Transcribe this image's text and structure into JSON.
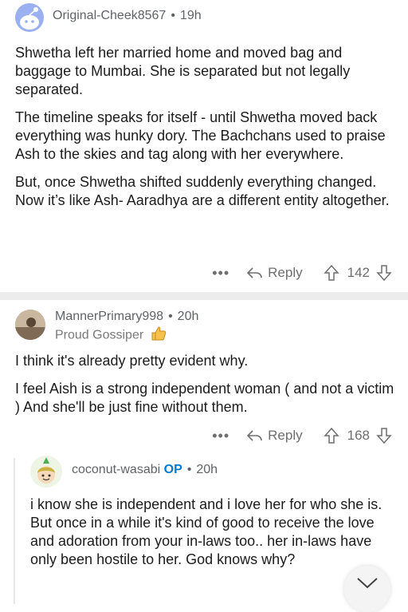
{
  "comment1": {
    "username": "Original-Cheek8567",
    "time": "19h",
    "paragraphs": [
      "Shwetha left her married home and moved bag and baggage to Mumbai. She is separated but not legally separated.",
      "The timeline speaks for itself - until Shwetha moved back everything was hunky dory. The Bachchans used to praise Ash to the skies and tag along with her everywhere.",
      "But, once Shwetha shifted suddenly everything changed. Now it’s like Ash- Aaradhya are a different entity altogether."
    ],
    "reply_label": "Reply",
    "score": "142"
  },
  "comment2": {
    "username": "MannerPrimary998",
    "time": "20h",
    "flair": "Proud Gossiper",
    "paragraphs": [
      "I think it's already pretty evident why.",
      "I feel Aish is a strong independent woman ( and not a victim ) And she'll be just fine without them."
    ],
    "reply_label": "Reply",
    "score": "168"
  },
  "comment3": {
    "username": "coconut-wasabi",
    "op_label": "OP",
    "time": "20h",
    "paragraphs": [
      "i know she is independent and i love her for who she is. But once in a while it's kind of good to receive the love and adoration from your in-laws too.. her in-laws have only been hostile to her. God knows why?"
    ]
  },
  "separator_dot": "•",
  "more_label": "•••",
  "icons": {
    "upvote": "arrow-up-icon",
    "downvote": "arrow-down-icon",
    "reply": "reply-arrow-icon",
    "collapse": "chevron-down-icon"
  },
  "colors": {
    "op_accent": "#0079d3",
    "avatar1_bg": "#9bb0f0",
    "separator": "#ececec"
  }
}
